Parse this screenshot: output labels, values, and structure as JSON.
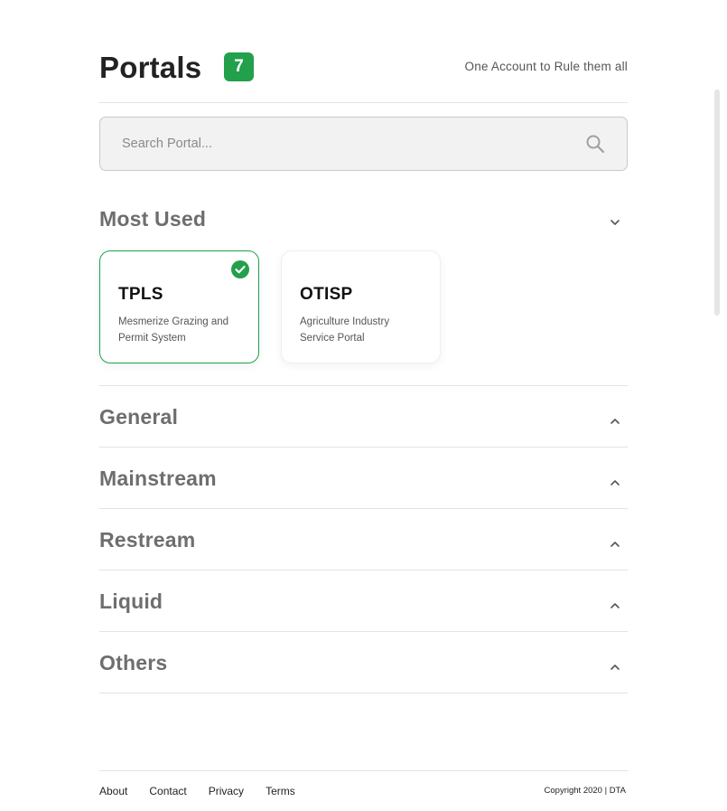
{
  "header": {
    "title": "Portals",
    "count": "7",
    "tagline": "One Account to Rule them all"
  },
  "search": {
    "placeholder": "Search Portal...",
    "value": "",
    "icon": "search-icon"
  },
  "most_used": {
    "title": "Most Used",
    "expanded": true,
    "cards": [
      {
        "code": "TPLS",
        "description": "Mesmerize Grazing and Permit System",
        "selected": true
      },
      {
        "code": "OTISP",
        "description": "Agriculture Industry Service Portal",
        "selected": false
      }
    ]
  },
  "sections": [
    {
      "title": "General"
    },
    {
      "title": "Mainstream"
    },
    {
      "title": "Restream"
    },
    {
      "title": "Liquid"
    },
    {
      "title": "Others"
    }
  ],
  "footer": {
    "links": [
      "About",
      "Contact",
      "Privacy",
      "Terms"
    ],
    "copyright": "Copyright 2020 | DTA"
  },
  "colors": {
    "accent": "#22a04b",
    "section_title": "#6e6e6e",
    "divider": "#e3e3e3",
    "search_bg": "#f2f2f2"
  }
}
